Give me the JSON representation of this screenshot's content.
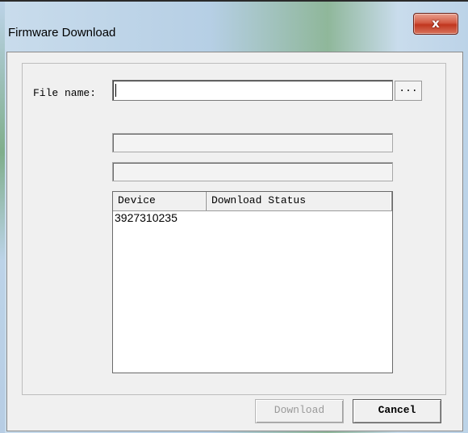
{
  "window": {
    "title": "Firmware Download",
    "close_label": "x"
  },
  "form": {
    "file_name_label": "File name:",
    "file_name_value": "",
    "browse_label": "..."
  },
  "device_list": {
    "columns": [
      "Device",
      "Download Status"
    ],
    "rows": [
      {
        "device": "3927310235",
        "status": ""
      }
    ]
  },
  "buttons": {
    "download": "Download",
    "cancel": "Cancel"
  },
  "colors": {
    "close_button": "#c1371f",
    "disabled_text": "#9a9a9a"
  }
}
